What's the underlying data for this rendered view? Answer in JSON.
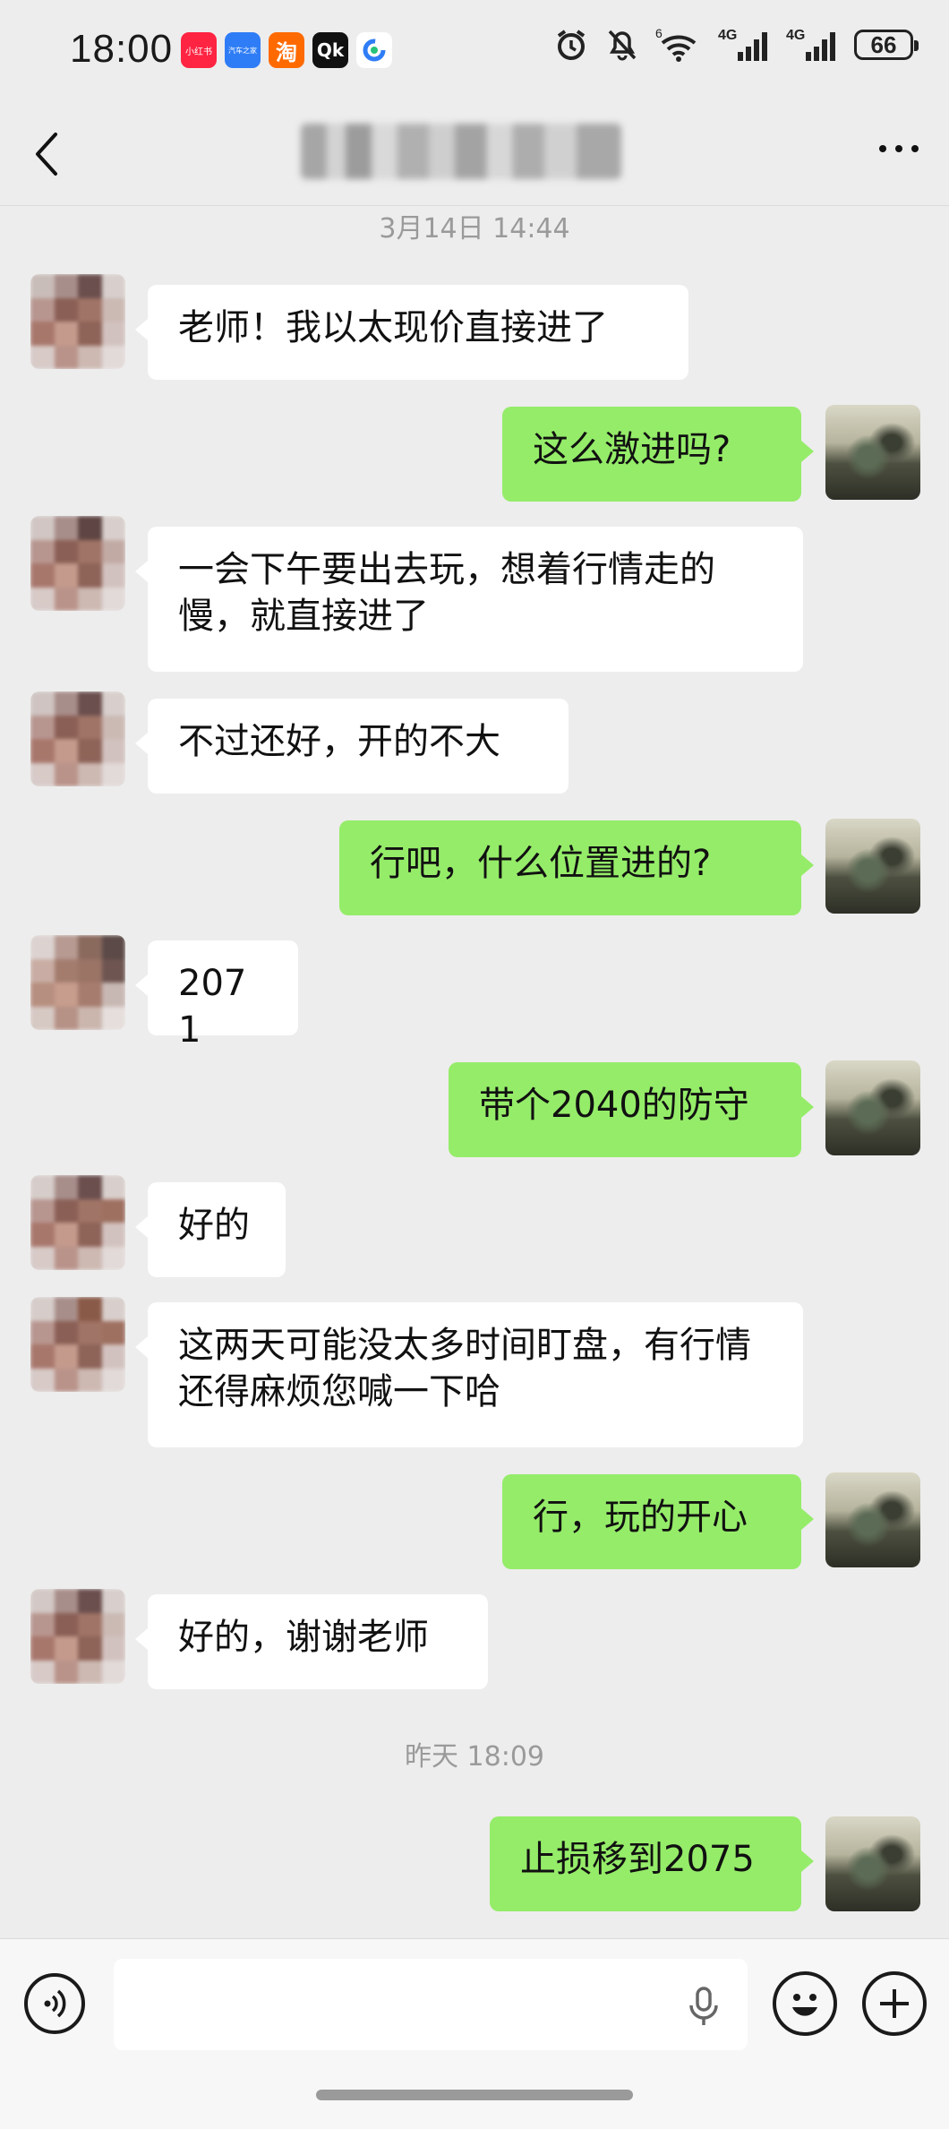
{
  "status_bar": {
    "time": "18:00",
    "apps": [
      {
        "icon": "xiaohongshu-icon",
        "label": "小红书",
        "color": "#ff2442"
      },
      {
        "icon": "autohome-icon",
        "label": "汽车之家",
        "color": "#2f7df6"
      },
      {
        "icon": "taobao-icon",
        "label": "淘",
        "color": "#ff6a00"
      },
      {
        "icon": "qk-icon",
        "label": "Qk",
        "color": "#111111"
      },
      {
        "icon": "browser-icon",
        "label": "",
        "color": "#ffffff"
      }
    ],
    "signal_1_label": "4G",
    "signal_2_label": "4G",
    "wifi_label": "6",
    "battery": "66"
  },
  "header": {
    "back_icon": "chevron-left-icon",
    "more_icon": "more-horizontal-icon"
  },
  "messages": {
    "timestamp_1": "3月14日 14:44",
    "m1": "老师！我以太现价直接进了",
    "m2": "这么激进吗?",
    "m3": "一会下午要出去玩，想着行情走的慢，就直接进了",
    "m4": "不过还好，开的不大",
    "m5": "行吧，什么位置进的?",
    "m6": "2071",
    "m7": "带个2040的防守",
    "m8": "好的",
    "m9": "这两天可能没太多时间盯盘，有行情还得麻烦您喊一下哈",
    "m10": "行，玩的开心",
    "m11": "好的，谢谢老师",
    "timestamp_2": "昨天 18:09",
    "m12": "止损移到2075"
  },
  "input_bar": {
    "voice_icon": "voice-icon",
    "mic_icon": "microphone-icon",
    "emoji_icon": "emoji-icon",
    "plus_icon": "plus-icon",
    "value": ""
  },
  "colors": {
    "background": "#ededed",
    "outgoing_bubble": "#95ec69",
    "incoming_bubble": "#ffffff"
  }
}
